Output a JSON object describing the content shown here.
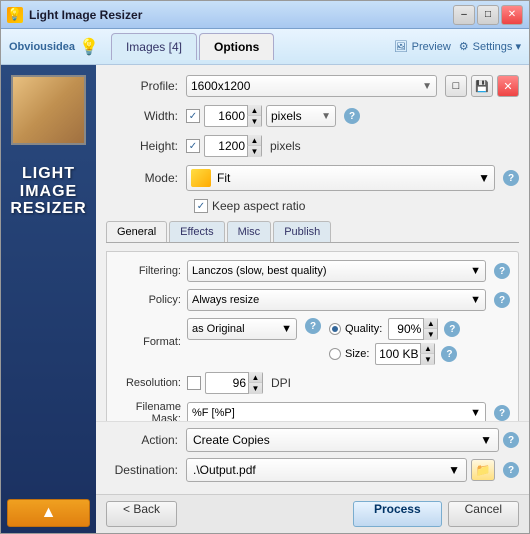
{
  "window": {
    "title": "Light Image Resizer",
    "minimize_label": "–",
    "maximize_label": "□",
    "close_label": "✕"
  },
  "toolbar": {
    "logo_emoji": "💡",
    "company": "Obviousidea",
    "tabs": [
      {
        "id": "images",
        "label": "Images [4]",
        "active": false
      },
      {
        "id": "options",
        "label": "Options",
        "active": true
      }
    ],
    "preview_label": "Preview",
    "settings_label": "Settings ▾"
  },
  "form": {
    "profile_label": "Profile:",
    "profile_value": "1600x1200",
    "width_label": "Width:",
    "width_value": "1600",
    "width_unit": "pixels",
    "height_label": "Height:",
    "height_value": "1200",
    "height_unit": "pixels",
    "mode_label": "Mode:",
    "mode_value": "Fit",
    "keep_aspect": "Keep aspect ratio"
  },
  "inner_tabs": [
    {
      "id": "general",
      "label": "General",
      "active": true
    },
    {
      "id": "effects",
      "label": "Effects",
      "active": false
    },
    {
      "id": "misc",
      "label": "Misc",
      "active": false
    },
    {
      "id": "publish",
      "label": "Publish",
      "active": false
    }
  ],
  "general": {
    "filtering_label": "Filtering:",
    "filtering_value": "Lanczos (slow, best quality)",
    "policy_label": "Policy:",
    "policy_value": "Always resize",
    "format_label": "Format:",
    "format_value": "as Original",
    "quality_label": "Quality:",
    "quality_value": "90%",
    "size_label": "Size:",
    "size_value": "100 KB",
    "resolution_label": "Resolution:",
    "resolution_value": "96",
    "resolution_unit": "DPI",
    "filename_label": "Filename Mask:",
    "filename_value": "%F [%P]"
  },
  "actions": {
    "action_label": "Action:",
    "action_value": "Create Copies",
    "destination_label": "Destination:",
    "destination_value": ".\\Output.pdf"
  },
  "buttons": {
    "back_label": "< Back",
    "process_label": "Process",
    "cancel_label": "Cancel"
  },
  "sidebar": {
    "logo_line1": "LIGHT",
    "logo_line2": "IMAGE",
    "logo_line3": "RESIZER",
    "arrow": "^"
  }
}
